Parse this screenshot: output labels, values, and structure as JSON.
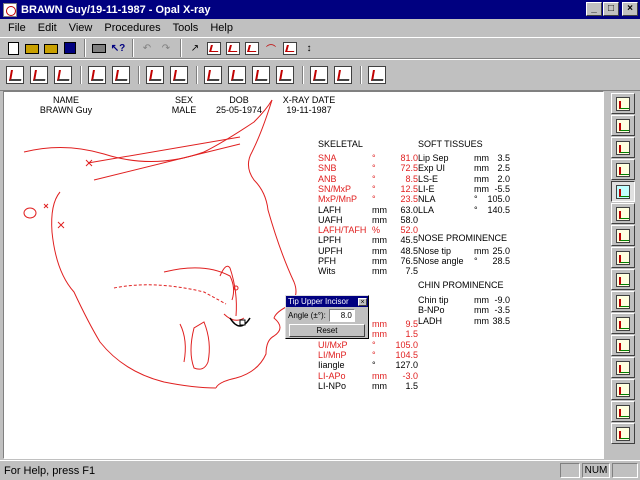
{
  "window": {
    "title": "BRAWN Guy/19-11-1987 - Opal X-ray"
  },
  "menu": [
    "File",
    "Edit",
    "View",
    "Procedures",
    "Tools",
    "Help"
  ],
  "toolbar1": [
    "new-icon",
    "open-icon",
    "open-folder-icon",
    "save-icon",
    "print-icon",
    "help-cursor-icon",
    "undo-icon",
    "redo-icon",
    "trace-icon",
    "point-icon",
    "point-red-icon",
    "point-move-icon",
    "curve-icon",
    "digitize-icon",
    "scale-icon"
  ],
  "toolbar2": [
    "trace-select-icon",
    "soft-tissue-icon",
    "teeth-icon",
    "superimpose-icon",
    "measure-grid-icon",
    "angle-icon",
    "angle-alt-icon",
    "move-maxilla-icon",
    "move-mandible-icon",
    "rotate-icon",
    "move-teeth-icon",
    "tooth-add-icon",
    "tooth-move-icon",
    "chin-icon"
  ],
  "sidebar": [
    "clear-icon",
    "report-icon",
    "angle-analysis-icon",
    "triangle-icon",
    "grid-icon",
    "active-grid-icon",
    "analysis-a-icon",
    "analysis-b-icon",
    "analysis-c-icon",
    "analysis-d-icon",
    "analysis-e-icon",
    "analysis-f-icon",
    "analysis-g-icon",
    "analysis-h-icon",
    "analysis-i-icon",
    "analysis-j-icon"
  ],
  "patient": {
    "headers": [
      "NAME",
      "SEX",
      "DOB",
      "X-RAY DATE"
    ],
    "values": [
      "BRAWN Guy",
      "MALE",
      "25-05-1974",
      "19-11-1987"
    ]
  },
  "skeletal": {
    "title": "SKELETAL",
    "rows": [
      {
        "label": "SNA",
        "unit": "°",
        "value": "81.0",
        "red": true
      },
      {
        "label": "SNB",
        "unit": "°",
        "value": "72.5",
        "red": true
      },
      {
        "label": "ANB",
        "unit": "°",
        "value": "8.5",
        "red": true
      },
      {
        "label": "SN/MxP",
        "unit": "°",
        "value": "12.5",
        "red": true
      },
      {
        "label": "MxP/MnP",
        "unit": "°",
        "value": "23.5",
        "red": true
      },
      {
        "label": "LAFH",
        "unit": "mm",
        "value": "63.0",
        "red": false
      },
      {
        "label": "UAFH",
        "unit": "mm",
        "value": "58.0",
        "red": false
      },
      {
        "label": "LAFH/TAFH",
        "unit": "%",
        "value": "52.0",
        "red": true
      },
      {
        "label": "LPFH",
        "unit": "mm",
        "value": "45.5",
        "red": false
      },
      {
        "label": "UPFH",
        "unit": "mm",
        "value": "48.5",
        "red": false
      },
      {
        "label": "PFH",
        "unit": "mm",
        "value": "76.5",
        "red": false
      },
      {
        "label": "Wits",
        "unit": "mm",
        "value": "7.5",
        "red": false
      }
    ]
  },
  "dental": {
    "rows": [
      {
        "label": "",
        "unit": "mm",
        "value": "9.5",
        "red": true
      },
      {
        "label": "",
        "unit": "mm",
        "value": "1.5",
        "red": true
      },
      {
        "label": "UI/MxP",
        "unit": "°",
        "value": "105.0",
        "red": true
      },
      {
        "label": "LI/MnP",
        "unit": "°",
        "value": "104.5",
        "red": true
      },
      {
        "label": "Iiangle",
        "unit": "°",
        "value": "127.0",
        "red": false
      },
      {
        "label": "LI-APo",
        "unit": "mm",
        "value": "-3.0",
        "red": true
      },
      {
        "label": "LI-NPo",
        "unit": "mm",
        "value": "1.5",
        "red": false
      }
    ]
  },
  "soft_tissues": {
    "title": "SOFT TISSUES",
    "rows": [
      {
        "label": "Lip Sep",
        "unit": "mm",
        "value": "3.5"
      },
      {
        "label": "Exp UI",
        "unit": "mm",
        "value": "2.5"
      },
      {
        "label": "LS-E",
        "unit": "mm",
        "value": "2.0"
      },
      {
        "label": "LI-E",
        "unit": "mm",
        "value": "-5.5"
      },
      {
        "label": "NLA",
        "unit": "°",
        "value": "105.0"
      },
      {
        "label": "LLA",
        "unit": "°",
        "value": "140.5"
      }
    ]
  },
  "nose": {
    "title": "NOSE PROMINENCE",
    "rows": [
      {
        "label": "Nose tip",
        "unit": "mm",
        "value": "25.0"
      },
      {
        "label": "Nose angle",
        "unit": "°",
        "value": "28.5"
      }
    ]
  },
  "chin": {
    "title": "CHIN PROMINENCE",
    "rows": [
      {
        "label": "Chin tip",
        "unit": "mm",
        "value": "-9.0"
      },
      {
        "label": "B-NPo",
        "unit": "mm",
        "value": "-3.5"
      },
      {
        "label": "LADH",
        "unit": "mm",
        "value": "38.5"
      }
    ]
  },
  "popup": {
    "title": "Tip Upper Incisor",
    "angle_label": "Angle (±°):",
    "angle_value": "8.0",
    "reset_label": "Reset"
  },
  "status": {
    "message": "For Help, press F1",
    "num": "NUM"
  },
  "colors": {
    "trace": "#e02020",
    "titlebar": "#000080",
    "face": "#c0c0c0"
  }
}
